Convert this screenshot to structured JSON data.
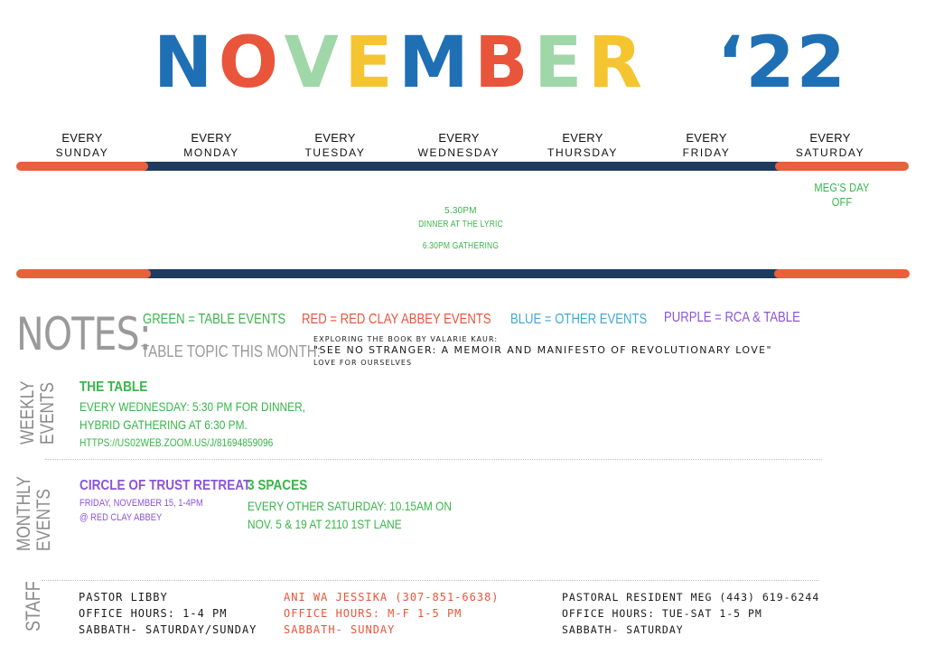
{
  "title": {
    "letters": [
      "N",
      "O",
      "V",
      "E",
      "M",
      "B",
      "E",
      "R"
    ],
    "year": "‘22",
    "colors": [
      "#1f6fb5",
      "#1f3a5f",
      "#9fd7a8",
      "#1f3a5f",
      "#1f6fb5",
      "#1f3a5f",
      "#9fd7a8",
      "#f4c531",
      "#1f6fb5",
      "#e8553a"
    ]
  },
  "days": [
    {
      "every": "EVERY",
      "name": "SUNDAY"
    },
    {
      "every": "EVERY",
      "name": "MONDAY"
    },
    {
      "every": "EVERY",
      "name": "TUESDAY"
    },
    {
      "every": "EVERY",
      "name": "WEDNESDAY"
    },
    {
      "every": "EVERY",
      "name": "THURSDAY"
    },
    {
      "every": "EVERY",
      "name": "FRIDAY"
    },
    {
      "every": "EVERY",
      "name": "SATURDAY"
    }
  ],
  "colors": {
    "navy": "#1f3a5f",
    "orange": "#e8603c",
    "green": "#39b54a",
    "red": "#e8553a",
    "blue": "#3fa9d5",
    "purple": "#8b54d8",
    "gray": "#9a9a9a"
  },
  "saturday_event": "MEG'S DAY OFF",
  "wednesday_events": {
    "time1": "5.30PM",
    "dinner": "DINNER AT THE LYRIC",
    "gathering": "6.30PM GATHERING"
  },
  "notes": {
    "title": "NOTES:",
    "legend": {
      "green": "GREEN = TABLE EVENTS",
      "red": "RED = RED CLAY ABBEY EVENTS",
      "blue": "BLUE = OTHER EVENTS",
      "purple": "PURPLE = RCA & TABLE"
    },
    "topic_label": "TABLE TOPIC THIS MONTH:",
    "topic_intro": "EXPLORING THE BOOK BY VALARIE KAUR:",
    "topic_book": "\"SEE NO STRANGER: A MEMOIR AND MANIFESTO OF REVOLUTIONARY LOVE\"",
    "topic_sub": "LOVE FOR OURSELVES"
  },
  "weekly": {
    "label_line1": "WEEKLY",
    "label_line2": "EVENTS",
    "title": "THE TABLE",
    "line1": "EVERY WEDNESDAY: 5:30 PM FOR DINNER,",
    "line2": "HYBRID GATHERING AT 6:30 PM.",
    "link": "HTTPS://US02WEB.ZOOM.US/J/81694859096"
  },
  "monthly": {
    "label_line1": "MONTHLY",
    "label_line2": "EVENTS",
    "retreat_title": "CIRCLE OF TRUST RETREAT",
    "retreat_date": "FRIDAY, NOVEMBER 15, 1-4PM",
    "retreat_place": "@ RED CLAY ABBEY",
    "spaces_title": "3 SPACES",
    "spaces_line1": "EVERY OTHER SATURDAY: 10.15AM ON",
    "spaces_line2": "NOV. 5 & 19  AT 2110 1ST LANE"
  },
  "staff": {
    "label": "STAFF",
    "libby": [
      "PASTOR LIBBY",
      "OFFICE HOURS: 1-4 PM",
      "SABBATH- SATURDAY/SUNDAY"
    ],
    "ani": [
      "ANI WA JESSIKA (307-851-6638)",
      "OFFICE HOURS: M-F 1-5 PM",
      "SABBATH- SUNDAY"
    ],
    "meg": [
      "PASTORAL RESIDENT MEG (443) 619-6244",
      "OFFICE HOURS: TUE-SAT 1-5 PM",
      "SABBATH- SATURDAY"
    ]
  }
}
